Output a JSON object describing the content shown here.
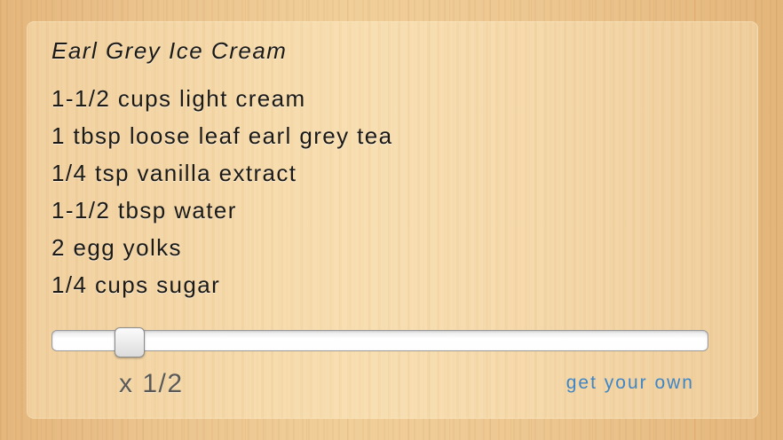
{
  "recipe": {
    "title": "Earl Grey Ice Cream",
    "ingredients": [
      "1-1/2 cups light cream",
      "1 tbsp loose leaf earl grey tea",
      "1/4 tsp vanilla extract",
      "1-1/2 tbsp water",
      "2 egg yolks",
      "1/4 cups sugar"
    ]
  },
  "scaler": {
    "value_fraction": 0.1,
    "multiplier_label": "x 1/2"
  },
  "footer": {
    "link_label": "get your own"
  },
  "colors": {
    "text": "#1c1a17",
    "multiplier": "#5b5955",
    "link": "#3f86c6"
  }
}
